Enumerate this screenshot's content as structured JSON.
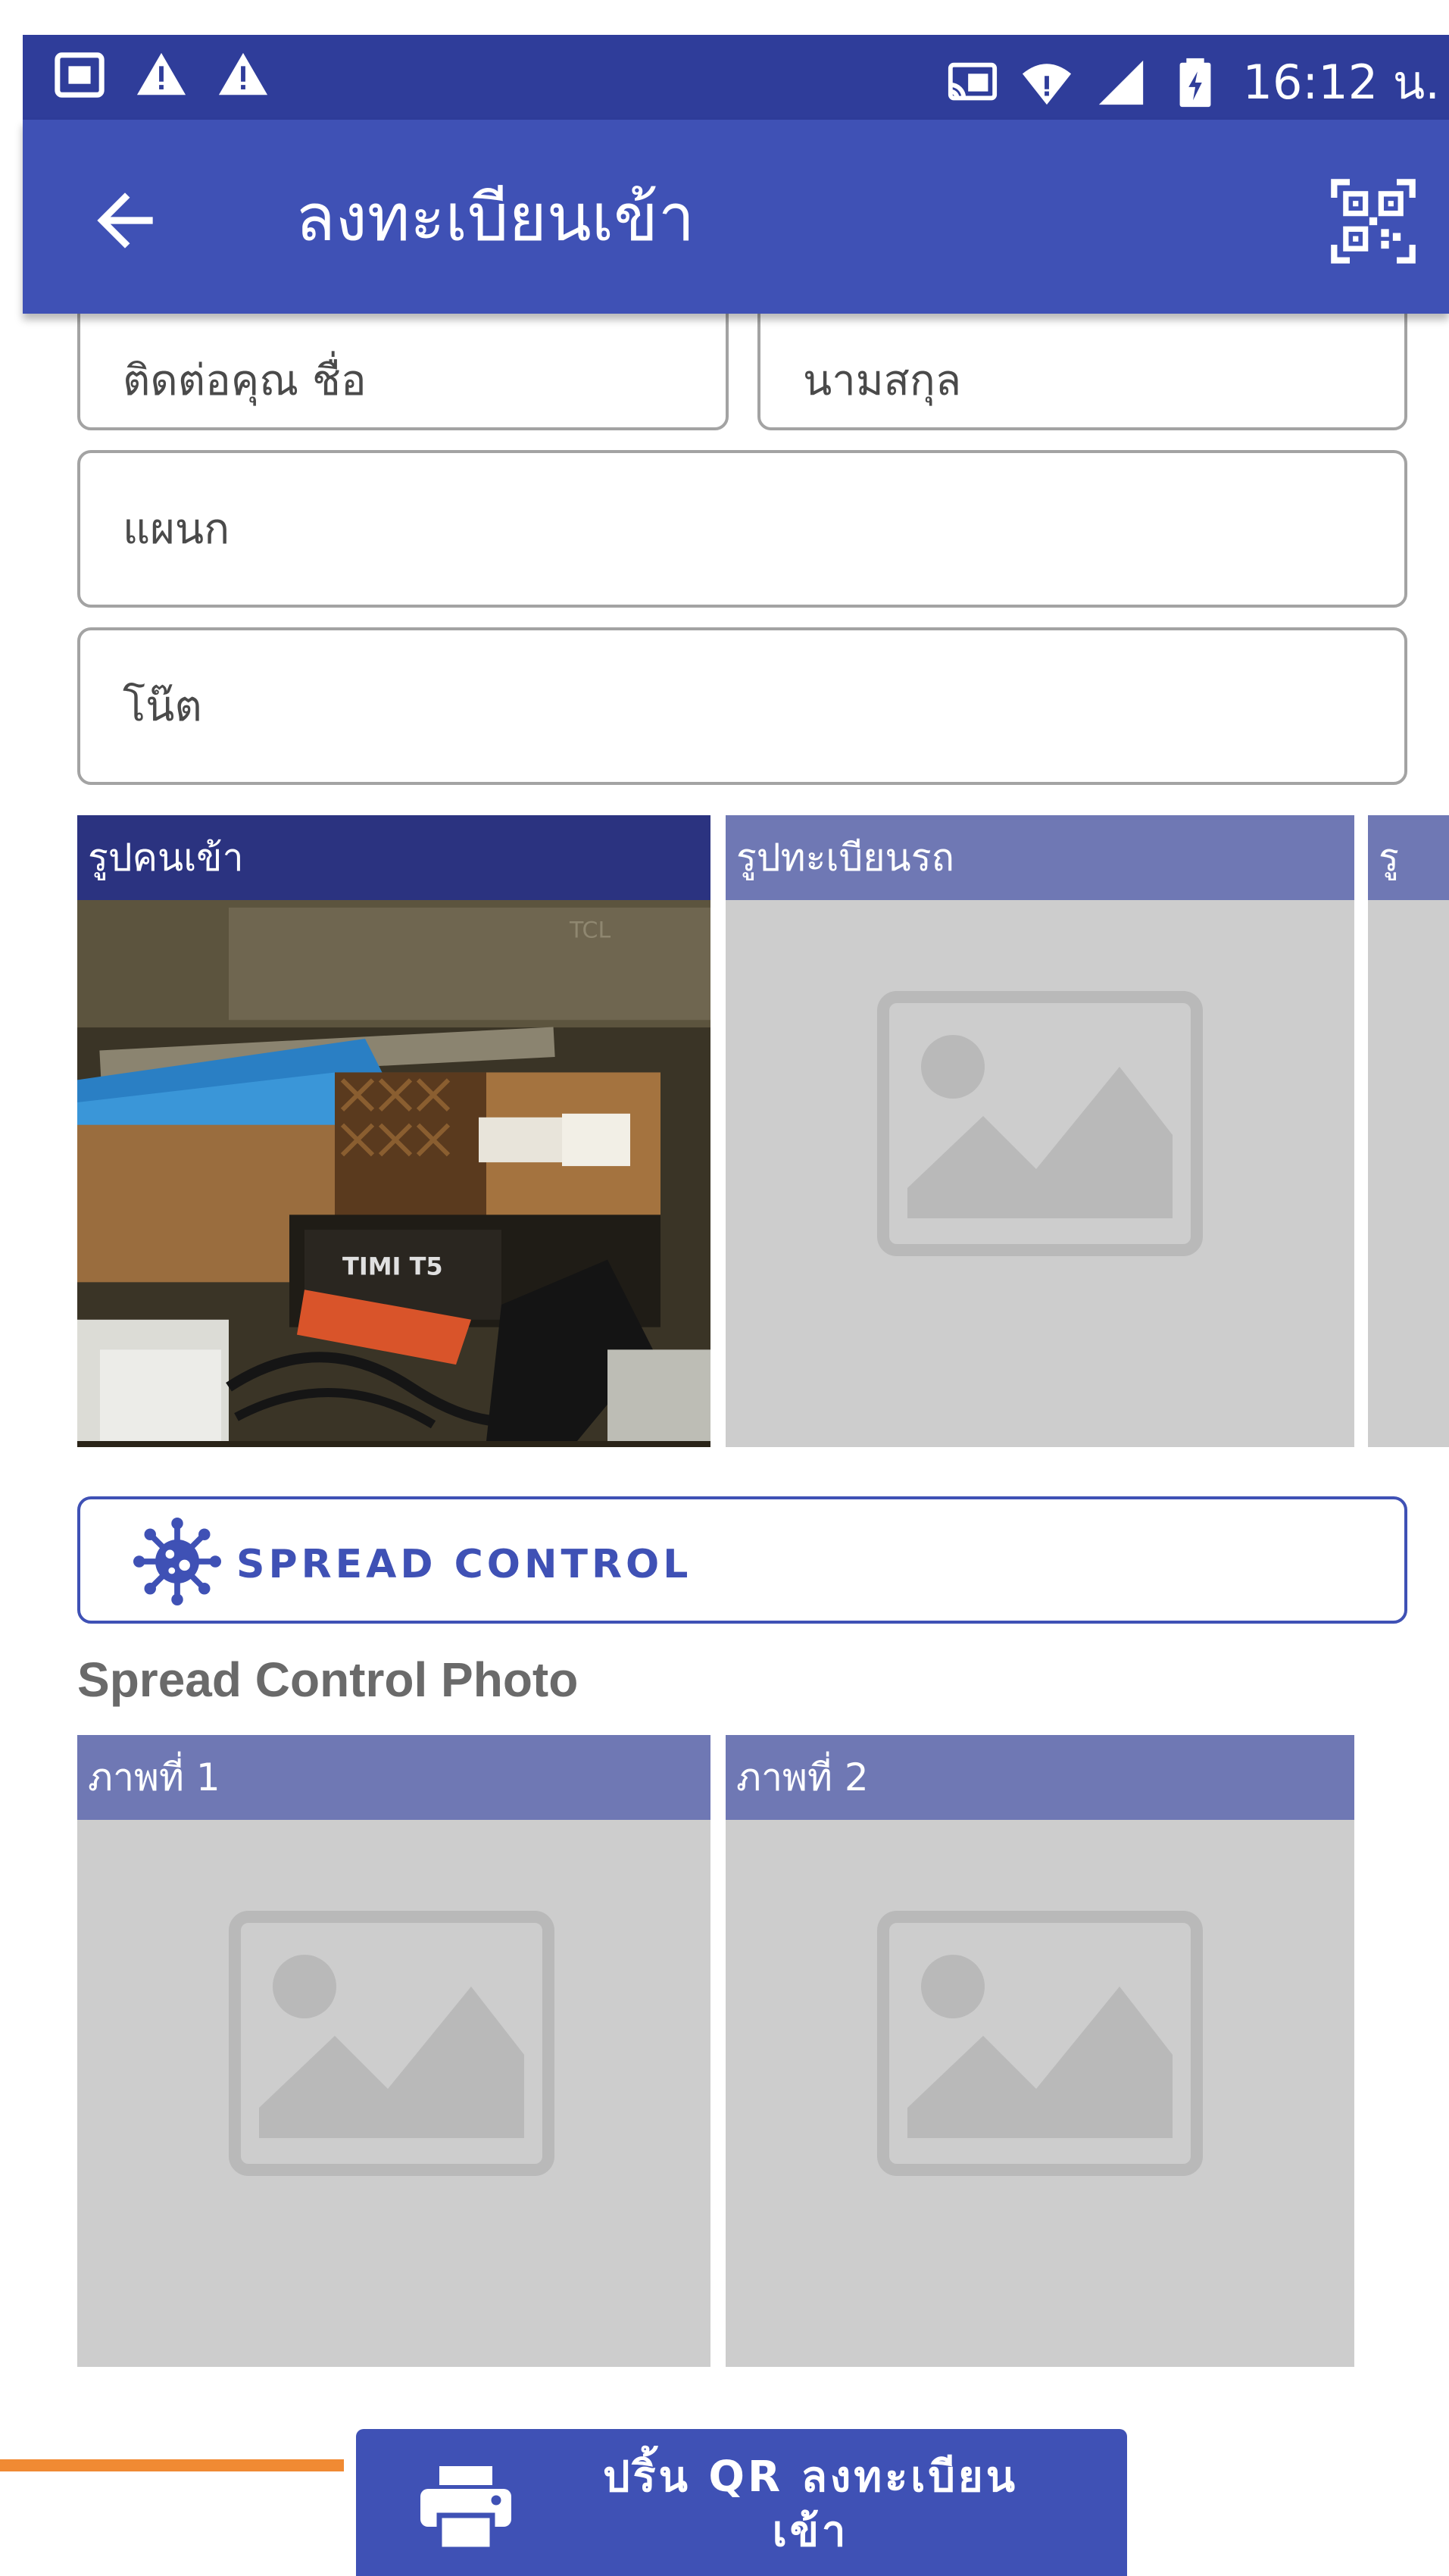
{
  "status_bar": {
    "time": "16:12 น.",
    "left_icons": [
      "screenshot-icon",
      "warning-icon",
      "warning-icon"
    ],
    "right_icons": [
      "cast-icon",
      "wifi-icon",
      "signal-icon",
      "battery-icon"
    ]
  },
  "app_bar": {
    "title": "ลงทะเบียนเข้า",
    "back_icon": "arrow-left-icon",
    "action_icon": "qr-code-scan-icon"
  },
  "form": {
    "contact_first_name": {
      "placeholder": "ติดต่อคุณ ชื่อ",
      "value": ""
    },
    "contact_last_name": {
      "placeholder": "นามสกุล",
      "value": ""
    },
    "department": {
      "placeholder": "แผนก",
      "value": ""
    },
    "note": {
      "placeholder": "โน๊ต",
      "value": ""
    }
  },
  "photos": [
    {
      "label": "รูปคนเข้า",
      "has_photo": true
    },
    {
      "label": "รูปทะเบียนรถ",
      "has_photo": false
    },
    {
      "label": "รู",
      "has_photo": false
    }
  ],
  "photo_scene_text": {
    "label_1": "TCL",
    "label_2": "TIMI T5"
  },
  "spread_control": {
    "button_label": "SPREAD CONTROL",
    "icon": "virus-icon",
    "section_title": "Spread Control Photo",
    "photos": [
      {
        "label": "ภาพที่ 1"
      },
      {
        "label": "ภาพที่ 2"
      }
    ]
  },
  "print_button": {
    "line1": "ปริ้น QR ลงทะเบียน",
    "line2": "เข้า",
    "icon": "printer-icon"
  },
  "colors": {
    "status_bar": "#2f3d9a",
    "app_bar": "#3f51b5",
    "tile_header": "#6f78b4",
    "tile_header_active": "#2b3380",
    "accent_orange": "#f08a33"
  }
}
